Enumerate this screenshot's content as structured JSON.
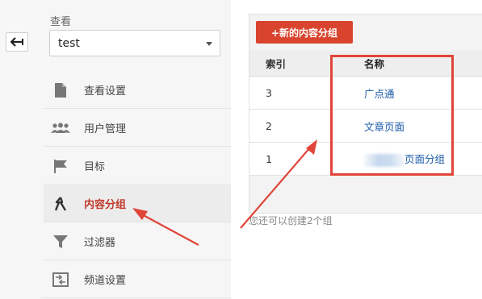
{
  "sidebar": {
    "view_label": "查看",
    "view_select_value": "test",
    "items": [
      {
        "label": "查看设置",
        "icon": "document-icon"
      },
      {
        "label": "用户管理",
        "icon": "users-icon"
      },
      {
        "label": "目标",
        "icon": "flag-icon"
      },
      {
        "label": "内容分组",
        "icon": "content-grouping-icon",
        "active": true
      },
      {
        "label": "过滤器",
        "icon": "filter-icon"
      },
      {
        "label": "频道设置",
        "icon": "channel-settings-icon"
      }
    ]
  },
  "main": {
    "new_button_label": "+新的内容分组",
    "table": {
      "headers": [
        "索引",
        "名称"
      ],
      "rows": [
        {
          "index": "3",
          "name": "广点通"
        },
        {
          "index": "2",
          "name": "文章页面"
        },
        {
          "index": "1",
          "name": "页面分组"
        }
      ]
    },
    "hint": "您还可以创建2个组"
  },
  "colors": {
    "accent": "#d9442e",
    "link": "#1a5aa8",
    "annotation": "#e0453a"
  }
}
